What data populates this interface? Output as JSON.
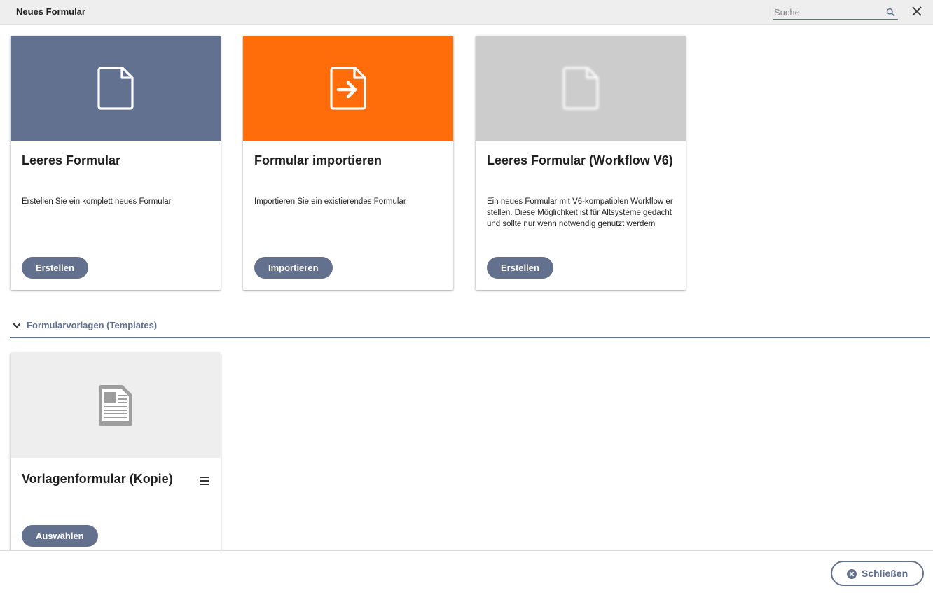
{
  "window": {
    "title": "Neues Formular"
  },
  "search": {
    "placeholder": "Suche"
  },
  "cards": [
    {
      "title": "Leeres Formular",
      "description": "Erstellen Sie ein komplett neues Formular",
      "button": "Erstellen",
      "hero_color": "#62718f",
      "icon": "blank-document-icon"
    },
    {
      "title": "Formular importieren",
      "description": "Importieren Sie ein existierendes Formular",
      "button": "Importieren",
      "hero_color": "#ff6d0a",
      "icon": "import-document-icon"
    },
    {
      "title": "Leeres Formular (Workflow V6)",
      "description": "Ein neues Formular mit V6-kompatiblen Workflow erstellen. Diese Möglichkeit ist für Altsysteme gedacht und sollte nur wenn notwendig genutzt werdem",
      "button": "Erstellen",
      "hero_color": "#cccccc",
      "icon": "blank-document-icon"
    }
  ],
  "templates_section": {
    "label": "Formularvorlagen (Templates)",
    "items": [
      {
        "title": "Vorlagenformular (Kopie)",
        "button": "Auswählen",
        "hero_color": "#eeeeee",
        "icon": "template-document-icon"
      }
    ]
  },
  "footer": {
    "close_label": "Schließen"
  },
  "colors": {
    "accent": "#63718f",
    "orange": "#ff6d0a"
  }
}
